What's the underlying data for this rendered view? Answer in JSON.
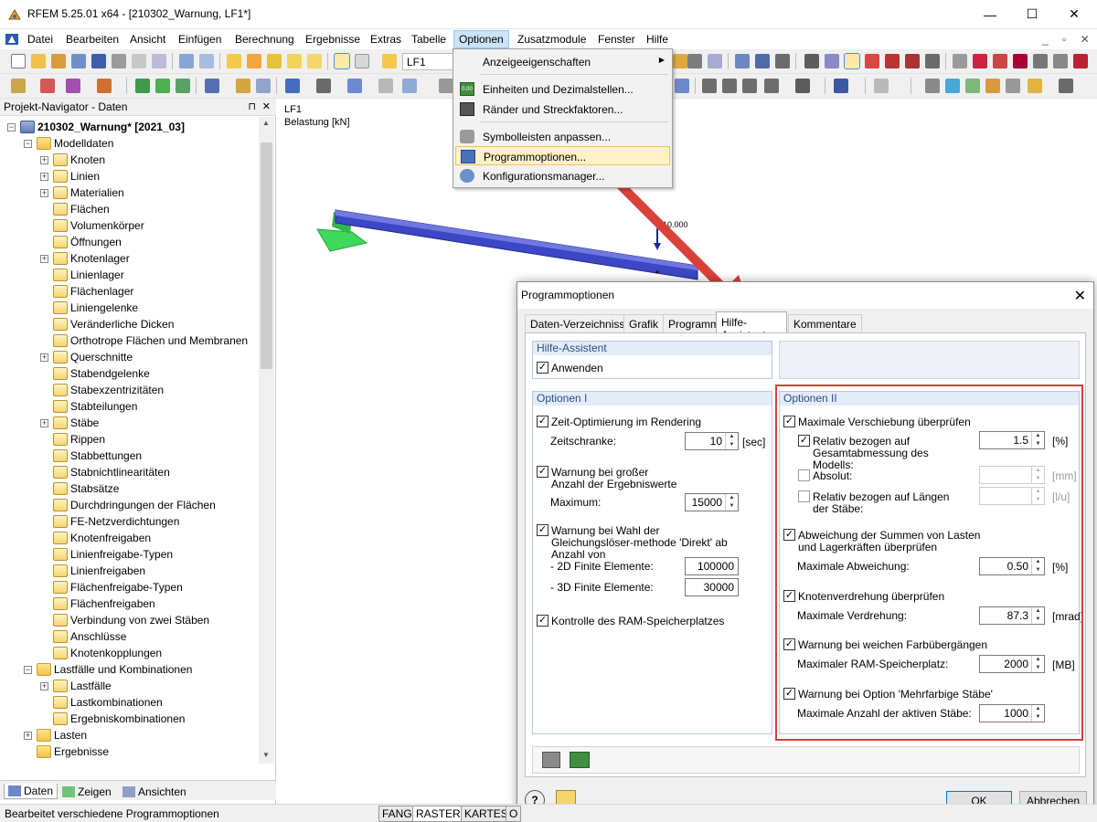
{
  "window": {
    "title": "RFEM 5.25.01 x64 - [210302_Warnung, LF1*]",
    "minimize": "—",
    "maximize": "☐",
    "close": "✕"
  },
  "menubar": {
    "items": [
      "Datei",
      "Bearbeiten",
      "Ansicht",
      "Einfügen",
      "Berechnung",
      "Ergebnisse",
      "Extras",
      "Tabelle",
      "Optionen",
      "Zusatzmodule",
      "Fenster",
      "Hilfe"
    ],
    "active": "Optionen",
    "mdi_controls": "_ ▫ ✕"
  },
  "toolbar": {
    "loadcase_combo": "LF1"
  },
  "navigator": {
    "title": "Projekt-Navigator - Daten",
    "pin": "⊓",
    "close": "✕",
    "project": "210302_Warnung* [2021_03]",
    "items": [
      {
        "label": "Modelldaten",
        "level": 1,
        "expander": "−",
        "folder": true
      },
      {
        "label": "Knoten",
        "level": 2,
        "expander": "+"
      },
      {
        "label": "Linien",
        "level": 2,
        "expander": "+"
      },
      {
        "label": "Materialien",
        "level": 2,
        "expander": "+"
      },
      {
        "label": "Flächen",
        "level": 2,
        "expander": ""
      },
      {
        "label": "Volumenkörper",
        "level": 2,
        "expander": ""
      },
      {
        "label": "Öffnungen",
        "level": 2,
        "expander": ""
      },
      {
        "label": "Knotenlager",
        "level": 2,
        "expander": "+"
      },
      {
        "label": "Linienlager",
        "level": 2,
        "expander": ""
      },
      {
        "label": "Flächenlager",
        "level": 2,
        "expander": ""
      },
      {
        "label": "Liniengelenke",
        "level": 2,
        "expander": ""
      },
      {
        "label": "Veränderliche Dicken",
        "level": 2,
        "expander": ""
      },
      {
        "label": "Orthotrope Flächen und Membranen",
        "level": 2,
        "expander": ""
      },
      {
        "label": "Querschnitte",
        "level": 2,
        "expander": "+"
      },
      {
        "label": "Stabendgelenke",
        "level": 2,
        "expander": ""
      },
      {
        "label": "Stabexzentrizitäten",
        "level": 2,
        "expander": ""
      },
      {
        "label": "Stabteilungen",
        "level": 2,
        "expander": ""
      },
      {
        "label": "Stäbe",
        "level": 2,
        "expander": "+"
      },
      {
        "label": "Rippen",
        "level": 2,
        "expander": ""
      },
      {
        "label": "Stabbettungen",
        "level": 2,
        "expander": ""
      },
      {
        "label": "Stabnichtlinearitäten",
        "level": 2,
        "expander": ""
      },
      {
        "label": "Stabsätze",
        "level": 2,
        "expander": ""
      },
      {
        "label": "Durchdringungen der Flächen",
        "level": 2,
        "expander": ""
      },
      {
        "label": "FE-Netzverdichtungen",
        "level": 2,
        "expander": ""
      },
      {
        "label": "Knotenfreigaben",
        "level": 2,
        "expander": ""
      },
      {
        "label": "Linienfreigabe-Typen",
        "level": 2,
        "expander": ""
      },
      {
        "label": "Linienfreigaben",
        "level": 2,
        "expander": ""
      },
      {
        "label": "Flächenfreigabe-Typen",
        "level": 2,
        "expander": ""
      },
      {
        "label": "Flächenfreigaben",
        "level": 2,
        "expander": ""
      },
      {
        "label": "Verbindung von zwei Stäben",
        "level": 2,
        "expander": ""
      },
      {
        "label": "Anschlüsse",
        "level": 2,
        "expander": ""
      },
      {
        "label": "Knotenkopplungen",
        "level": 2,
        "expander": ""
      },
      {
        "label": "Lastfälle und Kombinationen",
        "level": 1,
        "expander": "−",
        "folder": true
      },
      {
        "label": "Lastfälle",
        "level": 2,
        "expander": "+"
      },
      {
        "label": "Lastkombinationen",
        "level": 2,
        "expander": ""
      },
      {
        "label": "Ergebniskombinationen",
        "level": 2,
        "expander": ""
      },
      {
        "label": "Lasten",
        "level": 1,
        "expander": "+",
        "folder": true
      },
      {
        "label": "Ergebnisse",
        "level": 1,
        "expander": "",
        "folder": true
      }
    ],
    "tabs": [
      "Daten",
      "Zeigen",
      "Ansichten"
    ]
  },
  "viewport": {
    "case": "LF1",
    "load_label": "Belastung [kN]",
    "load_value": "10.000"
  },
  "options_menu": {
    "items": [
      {
        "label": "Anzeigeeigenschaften",
        "submenu": true
      },
      {
        "label": "Einheiten und Dezimalstellen...",
        "icon": "0.00"
      },
      {
        "label": "Ränder und Streckfaktoren..."
      },
      {
        "label": "Symbolleisten anpassen..."
      },
      {
        "label": "Programmoptionen...",
        "highlighted": true
      },
      {
        "label": "Konfigurationsmanager..."
      }
    ]
  },
  "dialog": {
    "title": "Programmoptionen",
    "close": "✕",
    "tabs": [
      "Daten-Verzeichnisse",
      "Grafik",
      "Programm",
      "Hilfe-Assistent",
      "Kommentare"
    ],
    "active_tab": "Hilfe-Assistent",
    "hilfe": {
      "heading": "Hilfe-Assistent",
      "apply_label": "Anwenden",
      "apply_checked": true
    },
    "options1": {
      "heading": "Optionen I",
      "render_label": "Zeit-Optimierung im Rendering",
      "render_checked": true,
      "time_label": "Zeitschranke:",
      "time_value": "10",
      "time_unit": "[sec]",
      "results_label": "Warnung bei großer Anzahl der Ergebniswerte",
      "results_checked": true,
      "max_label": "Maximum:",
      "max_value": "15000",
      "solver_label": "Warnung bei Wahl der Gleichungslöser-methode 'Direkt' ab Anzahl von",
      "solver_checked": true,
      "fe2d_label": "- 2D Finite Elemente:",
      "fe2d_value": "100000",
      "fe3d_label": "- 3D Finite Elemente:",
      "fe3d_value": "30000",
      "ram_label": "Kontrolle des RAM-Speicherplatzes",
      "ram_checked": true
    },
    "options2": {
      "heading": "Optionen II",
      "disp_label": "Maximale Verschiebung überprüfen",
      "disp_checked": true,
      "rel_label": "Relativ bezogen auf Gesamtabmessung des Modells:",
      "rel_checked": true,
      "rel_value": "1.5",
      "rel_unit": "[%]",
      "abs_label": "Absolut:",
      "abs_checked": false,
      "abs_value": "",
      "abs_unit": "[mm]",
      "rellen_label": "Relativ bezogen auf Längen der Stäbe:",
      "rellen_checked": false,
      "rellen_value": "",
      "rellen_unit": "[l/u]",
      "sum_label": "Abweichung der Summen von Lasten und Lagerkräften überprüfen",
      "sum_checked": true,
      "dev_label": "Maximale Abweichung:",
      "dev_value": "0.50",
      "dev_unit": "[%]",
      "rot_label": "Knotenverdrehung überprüfen",
      "rot_checked": true,
      "rotmax_label": "Maximale Verdrehung:",
      "rot_value": "87.3",
      "rot_unit": "[mrad]",
      "color_label": "Warnung bei weichen Farbübergängen",
      "color_checked": true,
      "ram_label": "Maximaler RAM-Speicherplatz:",
      "ram_value": "2000",
      "ram_unit": "[MB]",
      "multi_label": "Warnung bei Option 'Mehrfarbige Stäbe'",
      "multi_checked": true,
      "members_label": "Maximale Anzahl der aktiven Stäbe:",
      "members_value": "1000"
    },
    "ok": "OK",
    "cancel": "Abbrechen"
  },
  "statusbar": {
    "text": "Bearbeitet verschiedene Programmoptionen",
    "buttons": [
      "FANG",
      "RASTER",
      "KARTES",
      "O"
    ]
  },
  "colors": {
    "accent": "#0078d7",
    "annotation_red": "#d9403a",
    "menu_highlight": "#fff2c7",
    "beam": "#3b47c4",
    "support": "#3ed85a"
  }
}
